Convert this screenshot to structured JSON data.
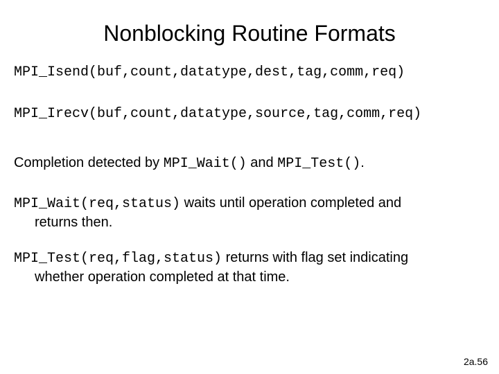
{
  "title": "Nonblocking Routine Formats",
  "isend": "MPI_Isend(buf,count,datatype,dest,tag,comm,req)",
  "irecv": "MPI_Irecv(buf,count,datatype,source,tag,comm,req)",
  "comp_prefix": "Completion detected by ",
  "comp_wait": "MPI_Wait()",
  "comp_mid": " and ",
  "comp_test": "MPI_Test()",
  "comp_suffix": ".",
  "wait_sig": "MPI_Wait(req,status)",
  "wait_desc1": " waits until operation completed and",
  "wait_desc2": "returns then.",
  "test_sig": "MPI_Test(req,flag,status)",
  "test_desc1": " returns with flag set indicating",
  "test_desc2": "whether operation completed at that time.",
  "footer": "2a.56"
}
